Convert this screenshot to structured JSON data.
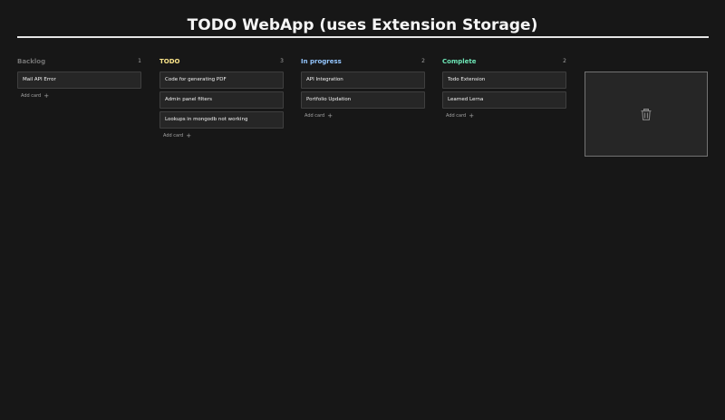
{
  "app": {
    "title": "TODO WebApp (uses Extension Storage)"
  },
  "add_card_label": "Add card",
  "add_card_icon": "+",
  "colors": {
    "background": "#171717",
    "backlog": "#737373",
    "todo": "#fde68a",
    "in_progress": "#93c5fd",
    "complete": "#6ee7b7"
  },
  "icons": {
    "trash": "trash-icon"
  },
  "columns": [
    {
      "title": "Backlog",
      "count": "1",
      "cards": [
        {
          "title": "Mail API Error"
        }
      ]
    },
    {
      "title": "TODO",
      "count": "3",
      "cards": [
        {
          "title": "Code for generating PDF"
        },
        {
          "title": "Admin panel filters"
        },
        {
          "title": "Lookups in mongodb not working"
        }
      ]
    },
    {
      "title": "In progress",
      "count": "2",
      "cards": [
        {
          "title": "API Integration"
        },
        {
          "title": "Portfolio Updation"
        }
      ]
    },
    {
      "title": "Complete",
      "count": "2",
      "cards": [
        {
          "title": "Todo Extension"
        },
        {
          "title": "Learned Lerna"
        }
      ]
    }
  ]
}
